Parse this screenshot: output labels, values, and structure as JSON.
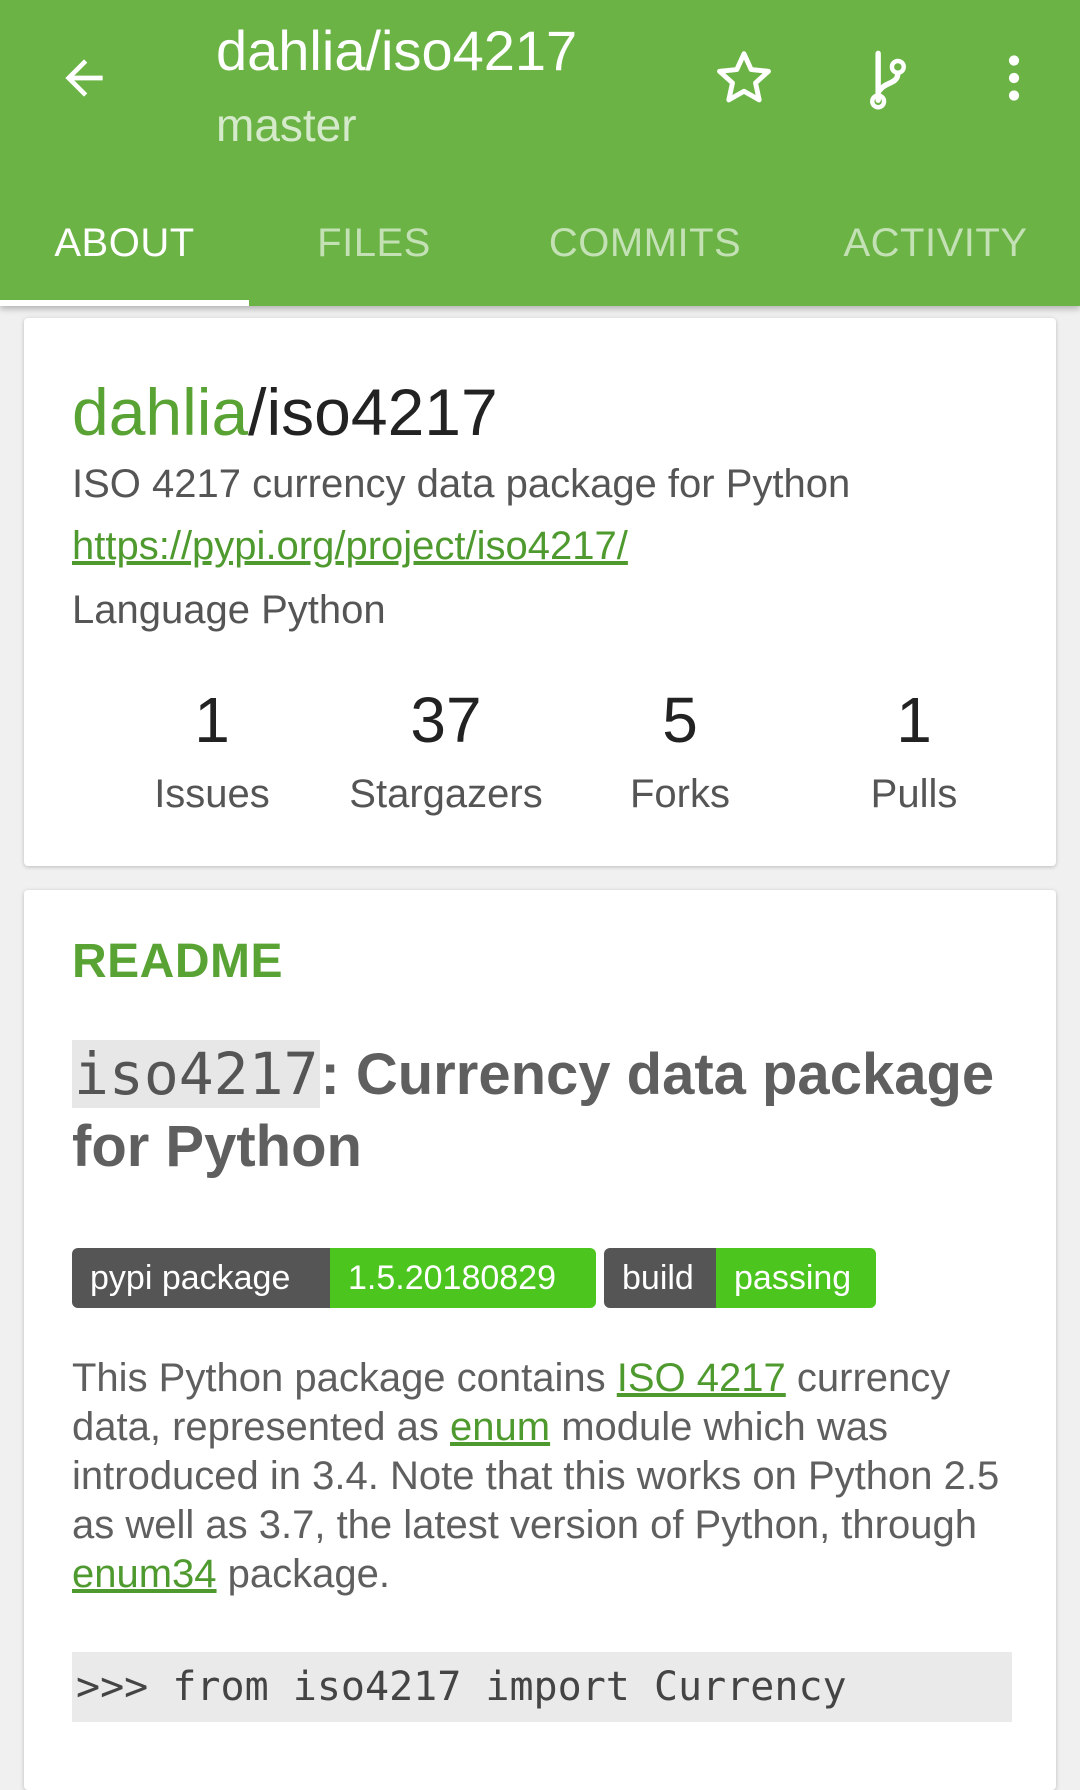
{
  "theme": {
    "accent": "#6ab344",
    "link": "#4f9a2f",
    "badge_dark": "#555555",
    "badge_green": "#4cc61e"
  },
  "appbar": {
    "title": "dahlia/iso4217",
    "subtitle": "master",
    "icons": [
      "back-arrow-icon",
      "star-icon",
      "branch-icon",
      "more-vert-icon"
    ]
  },
  "tabs": [
    {
      "label": "ABOUT",
      "active": true
    },
    {
      "label": "FILES",
      "active": false
    },
    {
      "label": "COMMITS",
      "active": false
    },
    {
      "label": "ACTIVITY",
      "active": false
    }
  ],
  "about": {
    "owner": "dahlia",
    "separator": "/",
    "repo": "iso4217",
    "description": "ISO 4217 currency data package for Python",
    "url": "https://pypi.org/project/iso4217/",
    "language": "Language Python",
    "stats": [
      {
        "value": "1",
        "label": "Issues"
      },
      {
        "value": "37",
        "label": "Stargazers"
      },
      {
        "value": "5",
        "label": "Forks"
      },
      {
        "value": "1",
        "label": "Pulls"
      }
    ]
  },
  "readme": {
    "label": "README",
    "heading_code": "iso4217",
    "heading_rest": ": Currency data package for Python",
    "badges": [
      {
        "left": "pypi package",
        "right": "1.5.20180829"
      },
      {
        "left": "build",
        "right": "passing"
      }
    ],
    "body": {
      "t1": "This Python package contains ",
      "link1": "ISO 4217",
      "t2": " currency data, represented as ",
      "link2": "enum",
      "t3": " module which was introduced in 3.4. Note that this works on Python 2.5 as well as 3.7, the latest version of Python, through ",
      "link3": "enum34",
      "t4": " package."
    },
    "code_line": ">>> from iso4217 import Currency"
  }
}
